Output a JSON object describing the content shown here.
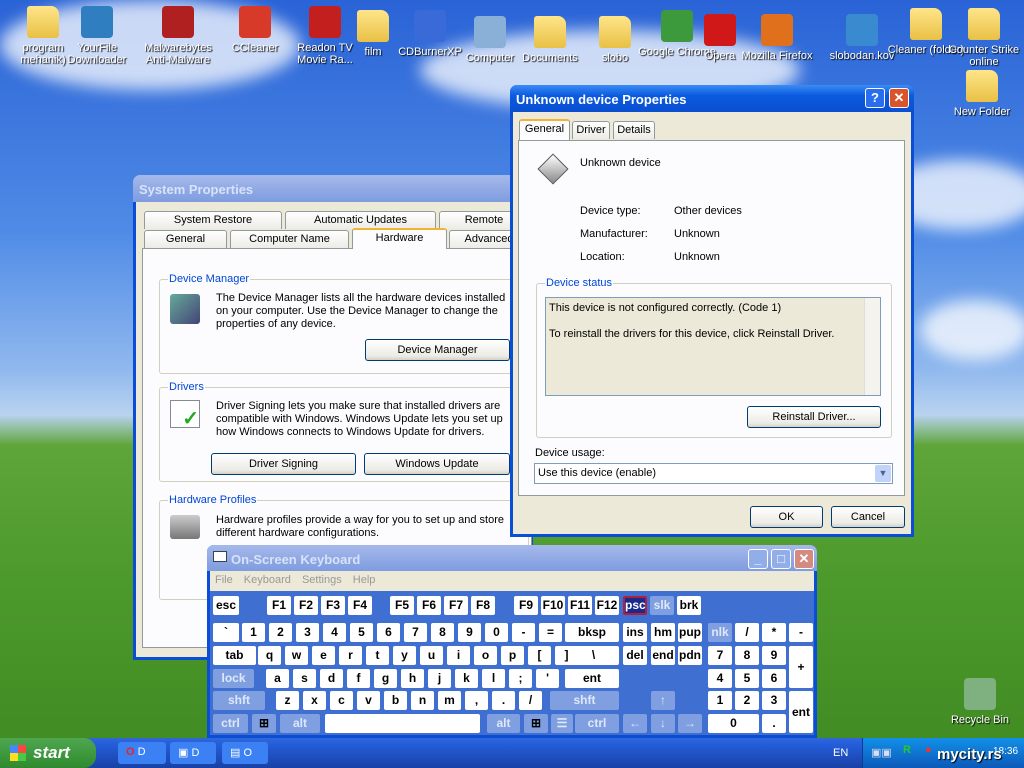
{
  "desktop": {
    "icons": [
      {
        "label": "program mehanik)",
        "type": "folder"
      },
      {
        "label": "YourFile Downloader",
        "type": "app",
        "color": "#2f7fc0"
      },
      {
        "label": "Malwarebytes Anti-Malware",
        "type": "app",
        "color": "#b02020"
      },
      {
        "label": "CCleaner",
        "type": "app",
        "color": "#d83a2a"
      },
      {
        "label": "Readon TV Movie Ra...",
        "type": "app",
        "color": "#c41f1f"
      },
      {
        "label": "film",
        "type": "folder"
      },
      {
        "label": "CDBurnerXP",
        "type": "app",
        "color": "#3a6ad8"
      },
      {
        "label": "Computer",
        "type": "app",
        "color": "#8ab0d8"
      },
      {
        "label": "Documents",
        "type": "folder"
      },
      {
        "label": "slobo",
        "type": "folder"
      },
      {
        "label": "Google Chrome",
        "type": "app",
        "color": "#3c9a3c"
      },
      {
        "label": "Opera",
        "type": "app",
        "color": "#d01818"
      },
      {
        "label": "Mozilla Firefox",
        "type": "app",
        "color": "#e0701c"
      },
      {
        "label": "slobodan.kov",
        "type": "app",
        "color": "#3a8ad0"
      },
      {
        "label": "Cleaner (folder)",
        "type": "folder"
      },
      {
        "label": "Counter Strike online",
        "type": "folder"
      },
      {
        "label": "New Folder",
        "type": "folder"
      },
      {
        "label": "Recycle Bin",
        "type": "app",
        "color": "#7fb07f"
      }
    ]
  },
  "system_properties": {
    "title": "System Properties",
    "tabs_row1": [
      "System Restore",
      "Automatic Updates",
      "Remote"
    ],
    "tabs_row2": [
      "General",
      "Computer Name",
      "Hardware",
      "Advanced"
    ],
    "device_manager": {
      "label": "Device Manager",
      "text": "The Device Manager lists all the hardware devices installed on your computer. Use the Device Manager to change the properties of any device.",
      "button": "Device Manager"
    },
    "drivers": {
      "label": "Drivers",
      "text": "Driver Signing lets you make sure that installed drivers are compatible with Windows. Windows Update lets you set up how Windows connects to Windows Update for drivers.",
      "button1": "Driver Signing",
      "button2": "Windows Update"
    },
    "hardware_profiles": {
      "label": "Hardware Profiles",
      "text": "Hardware profiles provide a way for you to set up and store different hardware configurations."
    }
  },
  "device_dialog": {
    "title": "Unknown device Properties",
    "help": "?",
    "tabs": [
      "General",
      "Driver",
      "Details"
    ],
    "device_name": "Unknown device",
    "props": [
      {
        "k": "Device type:",
        "v": "Other devices"
      },
      {
        "k": "Manufacturer:",
        "v": "Unknown"
      },
      {
        "k": "Location:",
        "v": "Unknown"
      }
    ],
    "status_label": "Device status",
    "status_line1": "This device is not configured correctly. (Code 1)",
    "status_line2": "To reinstall the drivers for this device, click Reinstall Driver.",
    "reinstall": "Reinstall Driver...",
    "usage_label": "Device usage:",
    "usage_value": "Use this device (enable)",
    "ok": "OK",
    "cancel": "Cancel"
  },
  "osk": {
    "title": "On-Screen Keyboard",
    "menu": [
      "File",
      "Keyboard",
      "Settings",
      "Help"
    ],
    "keys": [
      "esc",
      "F1",
      "F2",
      "F3",
      "F4",
      "F5",
      "F6",
      "F7",
      "F8",
      "F9",
      "F10",
      "F11",
      "F12",
      "psc",
      "slk",
      "brk",
      "`",
      "1",
      "2",
      "3",
      "4",
      "5",
      "6",
      "7",
      "8",
      "9",
      "0",
      "-",
      "=",
      "bksp",
      "ins",
      "hm",
      "pup",
      "nlk",
      "/",
      "*",
      "-",
      "tab",
      "q",
      "w",
      "e",
      "r",
      "t",
      "y",
      "u",
      "i",
      "o",
      "p",
      "[",
      "]",
      "\\",
      "del",
      "end",
      "pdn",
      "7",
      "8",
      "9",
      "+",
      "lock",
      "a",
      "s",
      "d",
      "f",
      "g",
      "h",
      "j",
      "k",
      "l",
      ";",
      "'",
      "ent",
      "4",
      "5",
      "6",
      "shft",
      "z",
      "x",
      "c",
      "v",
      "b",
      "n",
      "m",
      ",",
      ".",
      "/",
      "shft",
      "↑",
      "1",
      "2",
      "3",
      "ent",
      "ctrl",
      "⊞",
      "alt",
      "",
      "alt",
      "⊞",
      "☰",
      "ctrl",
      "←",
      "↓",
      "→",
      "0",
      "."
    ]
  },
  "taskbar": {
    "start": "start",
    "buttons": [
      "D",
      "D",
      "O"
    ],
    "language": "EN",
    "clock": "18:36",
    "watermark": "mycity.rs"
  }
}
